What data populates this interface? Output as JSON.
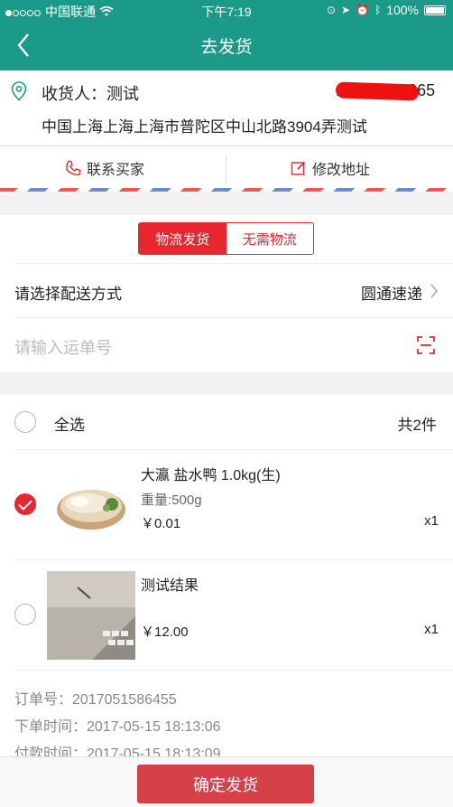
{
  "status_bar": {
    "carrier": "中国联通",
    "time": "下午7:19",
    "battery": "100%"
  },
  "nav": {
    "back_icon": "chevron-left-icon",
    "title": "去发货"
  },
  "address": {
    "receiver": "收货人：测试",
    "phone": "13760000065",
    "full_address": "中国上海上海上海市普陀区中山北路3904弄测试"
  },
  "actions": {
    "contact_buyer": "联系买家",
    "edit_address": "修改地址"
  },
  "logistics": {
    "tabs": [
      "物流发货",
      "无需物流"
    ],
    "active_tab": 0,
    "delivery_label": "请选择配送方式",
    "delivery_value": "圆通速递",
    "tracking_placeholder": "请输入运单号"
  },
  "goods": {
    "select_all_label": "全选",
    "total_count": "共2件",
    "items": [
      {
        "name": "大瀛 盐水鸭 1.0kg(生)",
        "weight": "重量:500g",
        "price": "￥0.01",
        "qty": "x1",
        "checked": true
      },
      {
        "name": "测试结果",
        "weight": "",
        "price": "￥12.00",
        "qty": "x1",
        "checked": false
      }
    ]
  },
  "order": {
    "order_no": "订单号：2017051586455",
    "order_time": "下单时间：2017-05-15 18:13:06",
    "pay_time": "付款时间：2017-05-15 18:13:09"
  },
  "confirm_button": "确定发货",
  "colors": {
    "brand": "#1b9a89",
    "accent": "#e8262f",
    "confirm": "#d64049"
  }
}
